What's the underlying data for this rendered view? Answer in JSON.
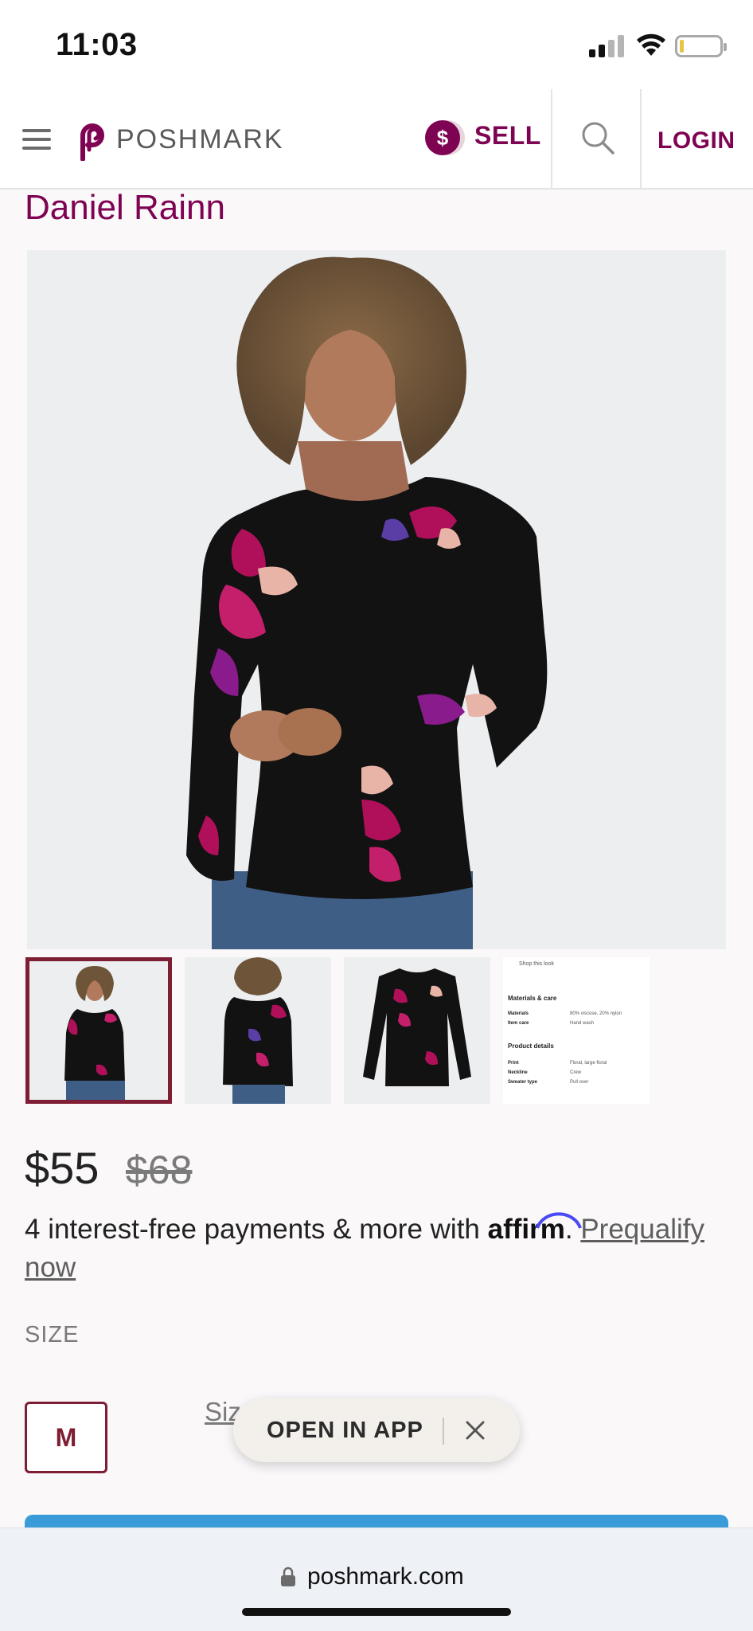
{
  "status_bar": {
    "time": "11:03"
  },
  "header": {
    "logo_text": "POSHMARK",
    "sell_label": "SELL",
    "sell_symbol": "$",
    "login_label": "LOGIN"
  },
  "listing": {
    "brand": "Daniel Rainn",
    "price": "$55",
    "original_price": "$68",
    "affirm_text": "4 interest-free payments & more with ",
    "affirm_brand": "affirm",
    "affirm_period": ". ",
    "prequalify_label": "Prequalify now",
    "size_heading": "SIZE",
    "size_option": "M",
    "size_chart_label": "Size Chart"
  },
  "thumbnail_doc": {
    "shop_the_look": "Shop this look",
    "materials_heading": "Materials & care",
    "materials_label": "Materials",
    "materials_value": "80% viscose, 20% nylon",
    "care_label": "Item care",
    "care_value": "Hand wash",
    "details_heading": "Product details",
    "print_label": "Print",
    "print_value": "Floral, large floral",
    "neckline_label": "Neckline",
    "neckline_value": "Crew",
    "sweater_label": "Sweater type",
    "sweater_value": "Pull over"
  },
  "open_app": {
    "label": "OPEN IN APP"
  },
  "browser": {
    "url": "poshmark.com"
  },
  "colors": {
    "brand_maroon": "#7f0353",
    "accent_blue": "#3a9bd9",
    "affirm_arc": "#4a4af4"
  }
}
